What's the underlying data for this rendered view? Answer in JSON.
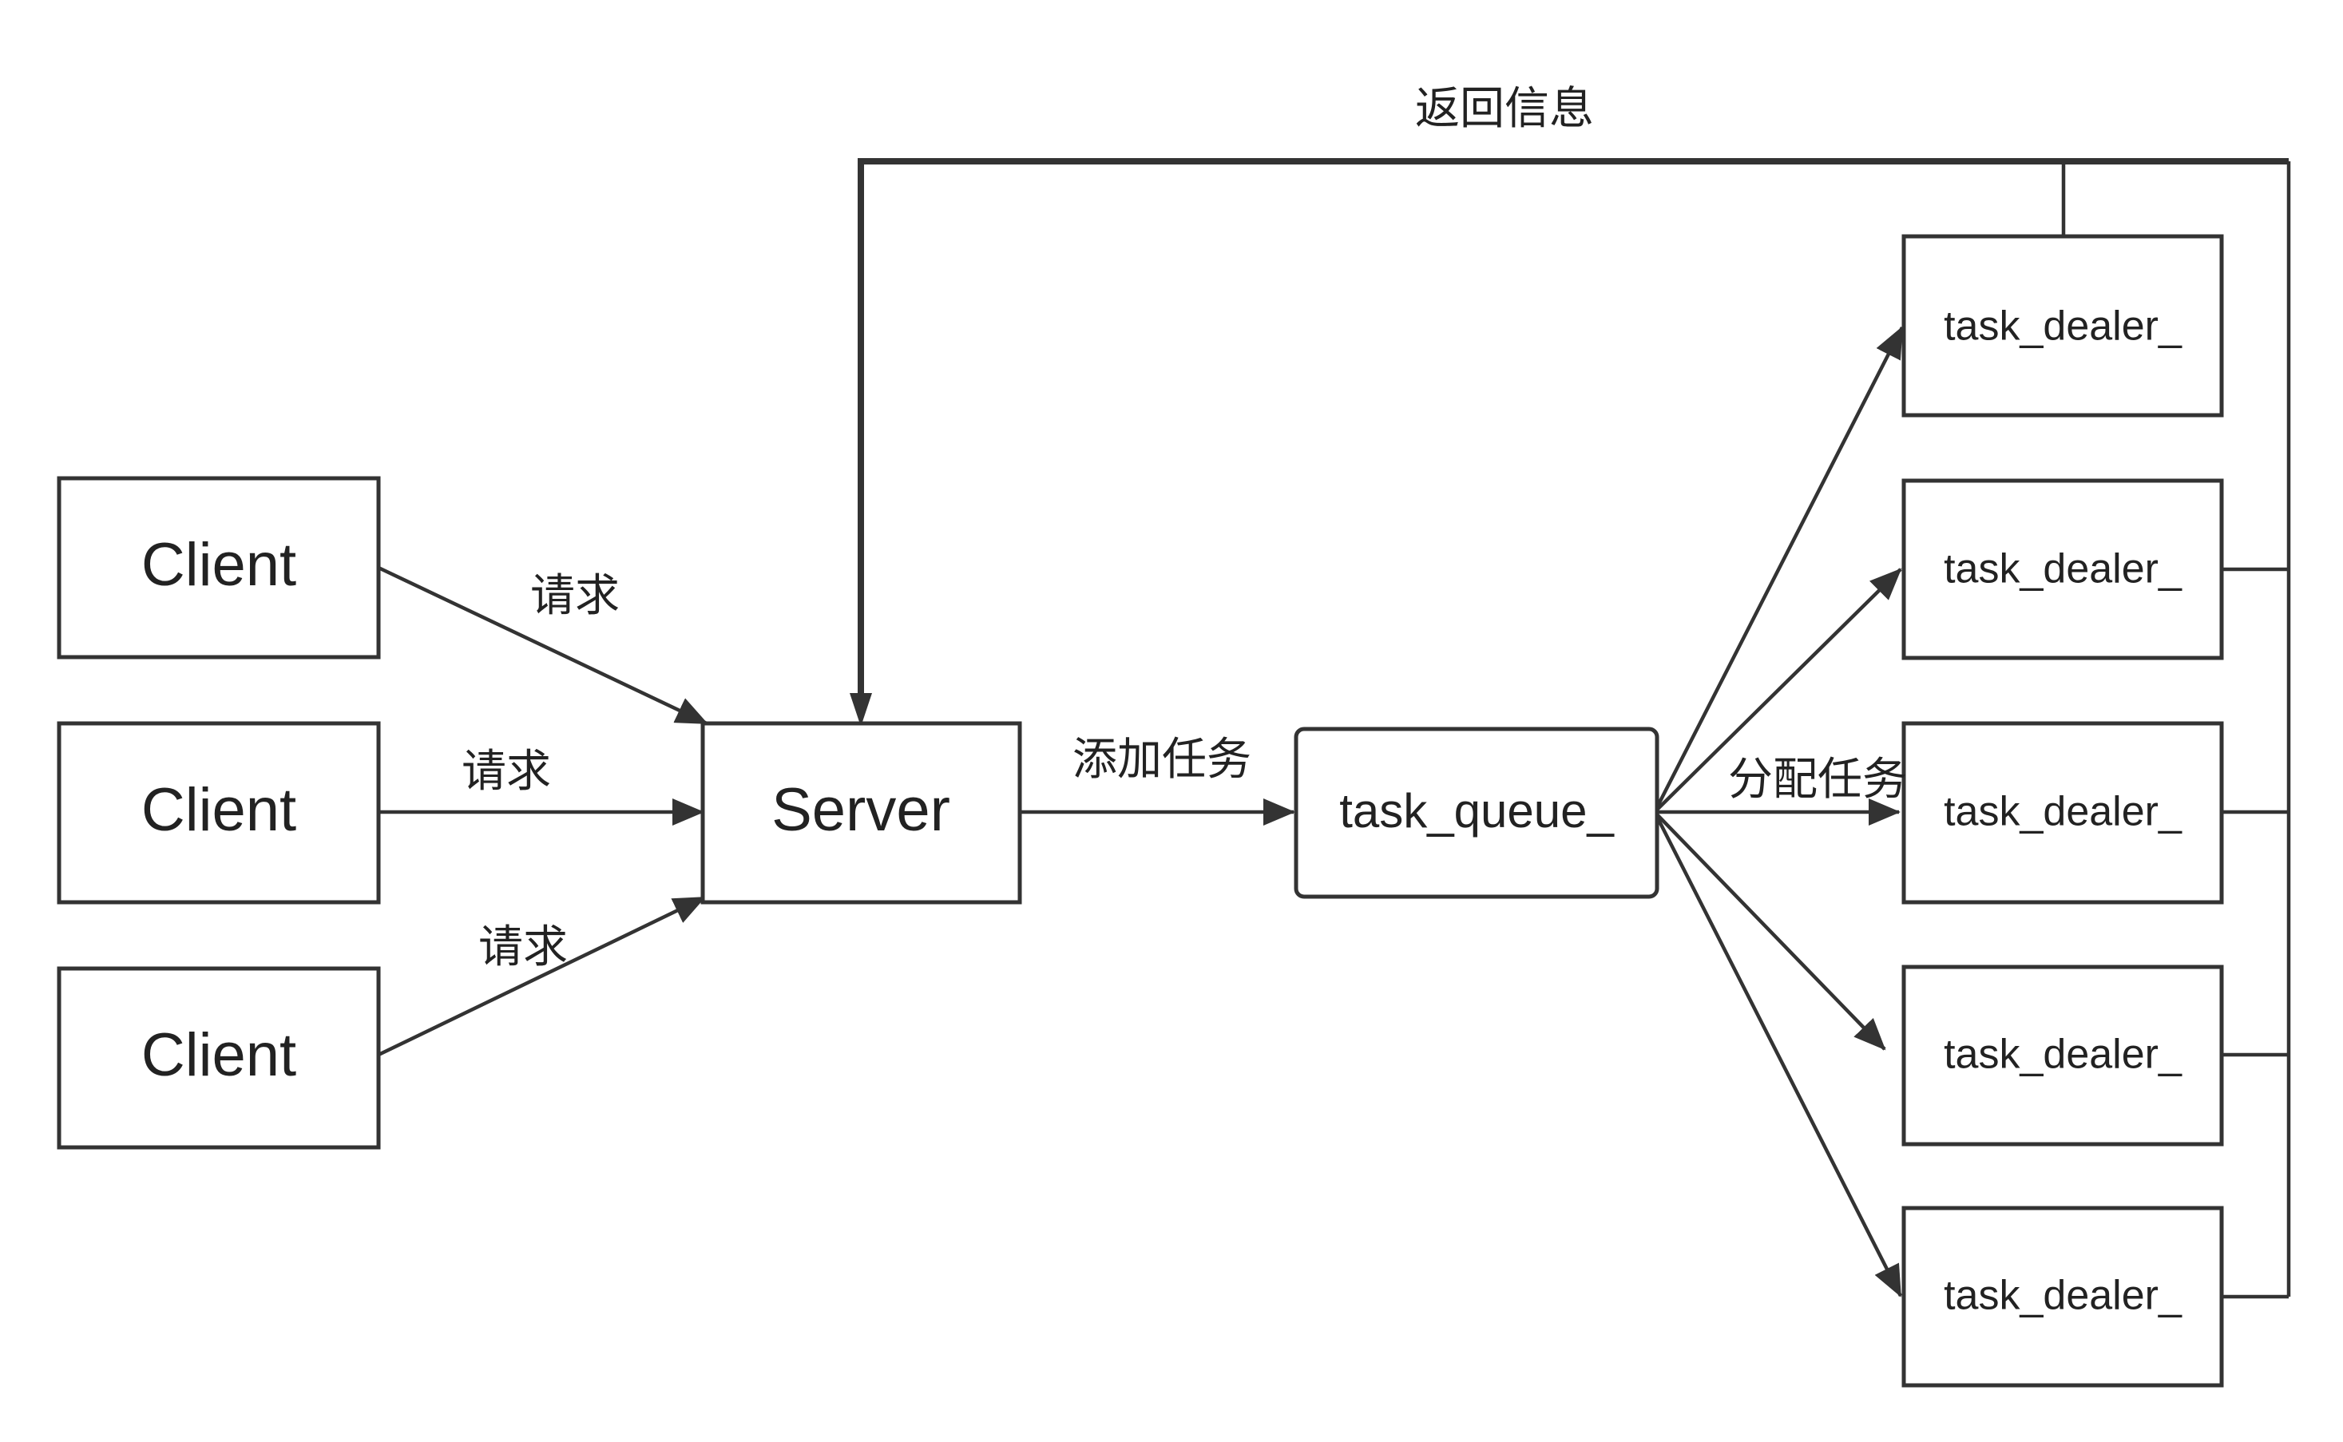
{
  "nodes": {
    "clients": [
      "Client",
      "Client",
      "Client"
    ],
    "server": "Server",
    "queue": "task_queue_",
    "dealers": [
      "task_dealer_",
      "task_dealer_",
      "task_dealer_",
      "task_dealer_",
      "task_dealer_"
    ]
  },
  "edges": {
    "request_labels": [
      "请求",
      "请求",
      "请求"
    ],
    "add_task": "添加任务",
    "assign_task": "分配任务",
    "return_info": "返回信息"
  },
  "colors": {
    "stroke": "#333333",
    "text": "#222222",
    "background": "#ffffff"
  }
}
